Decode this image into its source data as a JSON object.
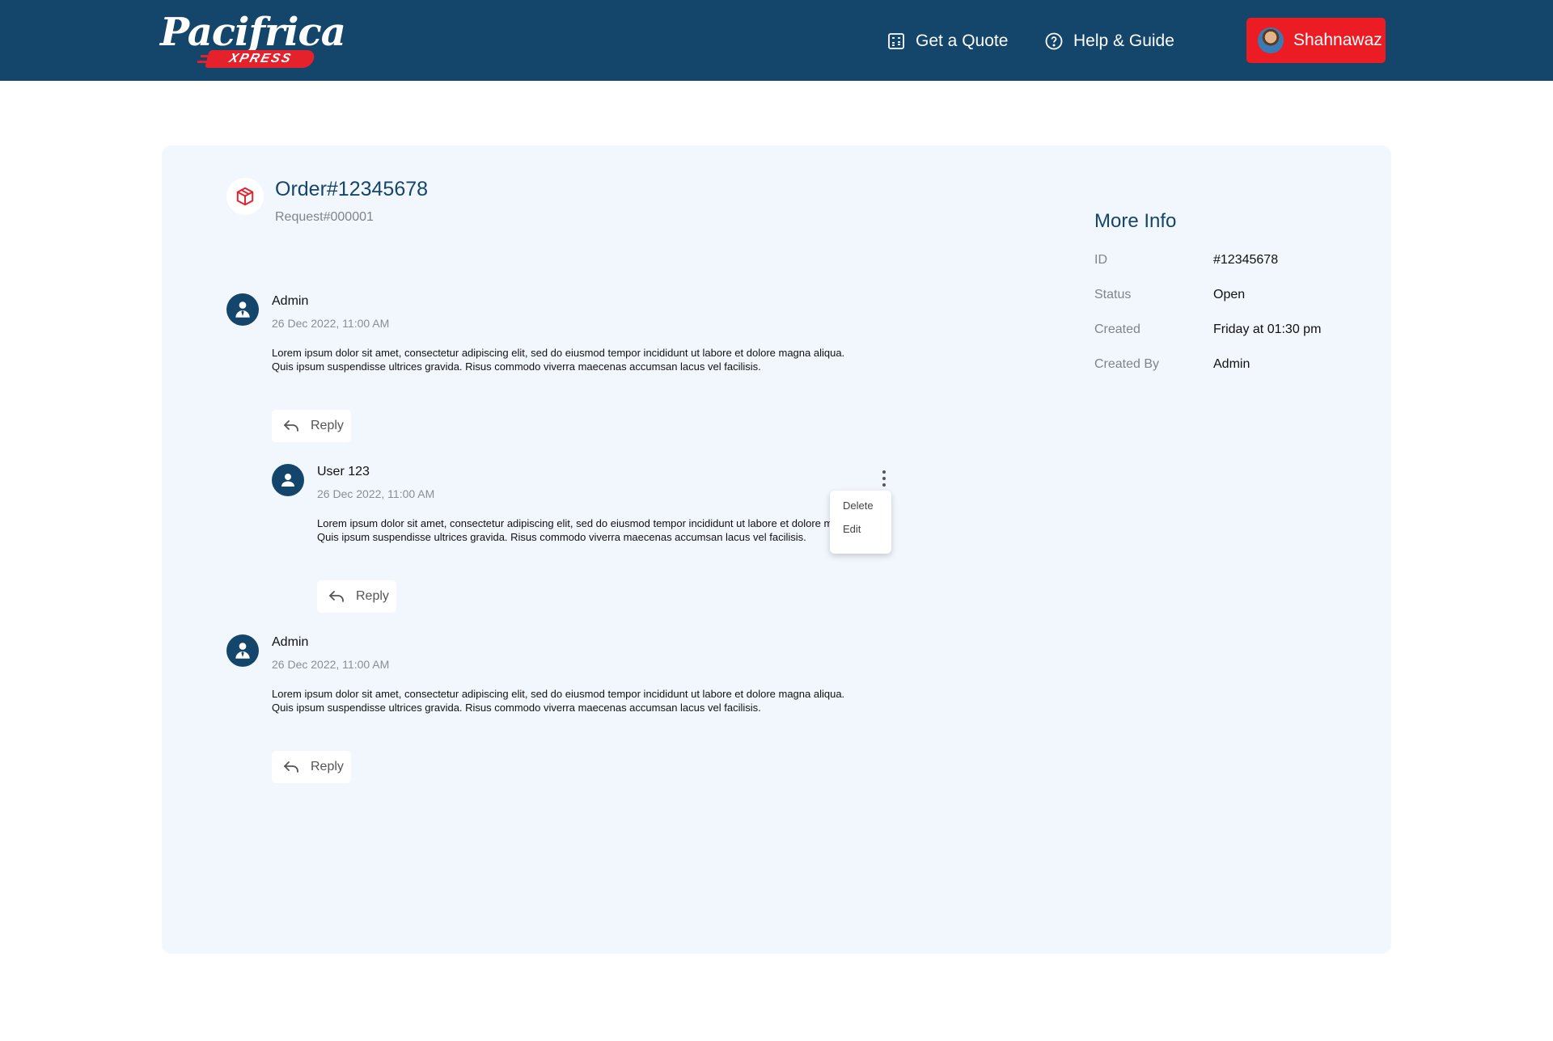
{
  "header": {
    "logo_text": "Pacifrica",
    "logo_sub": "XPRESS",
    "nav": {
      "quote_label": "Get a Quote",
      "help_label": "Help & Guide"
    },
    "user": {
      "name": "Shahnawaz"
    }
  },
  "order": {
    "title": "Order#12345678",
    "request": "Request#000001"
  },
  "comments": [
    {
      "author": "Admin",
      "date": "26 Dec 2022, 11:00 AM",
      "text": "Lorem ipsum dolor sit amet, consectetur adipiscing elit, sed do eiusmod tempor incididunt ut labore et dolore magna aliqua. Quis ipsum suspendisse ultrices gravida. Risus commodo viverra maecenas accumsan lacus vel facilisis.",
      "reply_label": "Reply"
    },
    {
      "author": "User 123",
      "date": "26 Dec 2022, 11:00 AM",
      "text": "Lorem ipsum dolor sit amet, consectetur adipiscing elit, sed do eiusmod tempor incididunt ut labore et dolore magna aliqua. Quis ipsum suspendisse ultrices gravida. Risus commodo viverra maecenas accumsan lacus vel facilisis.",
      "reply_label": "Reply"
    },
    {
      "author": "Admin",
      "date": "26 Dec 2022, 11:00 AM",
      "text": "Lorem ipsum dolor sit amet, consectetur adipiscing elit, sed do eiusmod tempor incididunt ut labore et dolore magna aliqua. Quis ipsum suspendisse ultrices gravida. Risus commodo viverra maecenas accumsan lacus vel facilisis.",
      "reply_label": "Reply"
    }
  ],
  "context_menu": {
    "delete_label": "Delete",
    "edit_label": "Edit"
  },
  "more_info": {
    "title": "More Info",
    "rows": [
      {
        "label": "ID",
        "value": "#12345678"
      },
      {
        "label": "Status",
        "value": "Open"
      },
      {
        "label": "Created",
        "value": "Friday at 01:30 pm"
      },
      {
        "label": "Created By",
        "value": "Admin"
      }
    ]
  },
  "colors": {
    "header_bg": "#13466a",
    "accent_red": "#ec1c24",
    "panel_bg": "#f2f6fd"
  }
}
